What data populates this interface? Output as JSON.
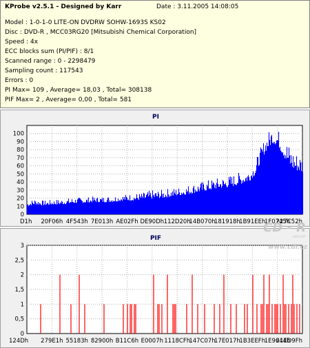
{
  "info": {
    "header": "KProbe v2.5.1 - Designed by Karr",
    "date": "Date : 3.11.2005 14:08:05",
    "lines": [
      "Model : 1-0-1-0 LITE-ON DVDRW SOHW-1693S KS02",
      "Disc : DVD-R , MCC03RG20 [Mitsubishi Chemical Corporation]",
      "Speed : 4x",
      "ECC blocks sum (PI/PIF) : 8/1",
      "Scanned range : 0 - 2298479",
      "Sampling count : 117543",
      "Errors : 0",
      "PI Max= 109 , Average= 18,03 , Total= 308138",
      "PIF Max= 2 , Average= 0,00 , Total= 581"
    ]
  },
  "watermark": {
    "brand": "CD - R",
    "sub": "server",
    "url": "www.cdr.cz"
  },
  "chart_data": [
    {
      "type": "area",
      "title": "PI",
      "color": "#0000ff",
      "ylim": [
        0,
        110
      ],
      "yticks": [
        0,
        10,
        20,
        30,
        40,
        50,
        60,
        70,
        80,
        90,
        100
      ],
      "xticks": [
        "D1h",
        "20F06h",
        "4F543h",
        "7E013h",
        "AE02Fh",
        "DE90Dh",
        "112D20h",
        "14B070h",
        "181918h",
        "1B91EEh",
        "1F0745h",
        "227C52h"
      ],
      "x_fraction": [
        0,
        0.03,
        0.06,
        0.09,
        0.12,
        0.15,
        0.18,
        0.21,
        0.24,
        0.27,
        0.3,
        0.33,
        0.36,
        0.39,
        0.42,
        0.45,
        0.48,
        0.51,
        0.54,
        0.57,
        0.6,
        0.63,
        0.66,
        0.69,
        0.72,
        0.75,
        0.78,
        0.81,
        0.83,
        0.85,
        0.87,
        0.89,
        0.91,
        0.93,
        0.95,
        0.97,
        1.0
      ],
      "base": [
        10,
        12,
        11,
        12,
        12,
        13,
        14,
        14,
        15,
        15,
        15,
        16,
        17,
        17,
        18,
        19,
        20,
        21,
        23,
        24,
        26,
        28,
        30,
        32,
        33,
        35,
        38,
        42,
        50,
        68,
        80,
        88,
        85,
        72,
        60,
        55,
        52
      ],
      "peak": [
        16,
        20,
        17,
        18,
        19,
        20,
        21,
        21,
        22,
        22,
        23,
        24,
        25,
        26,
        27,
        30,
        30,
        32,
        33,
        35,
        38,
        40,
        43,
        45,
        47,
        50,
        53,
        58,
        68,
        85,
        100,
        109,
        105,
        98,
        88,
        78,
        74
      ]
    },
    {
      "type": "bar",
      "title": "PIF",
      "color": "#ff0000",
      "ylim": [
        0,
        3
      ],
      "yticks": [
        "0",
        "0,5",
        "1",
        "1,5",
        "2",
        "2,5",
        "3"
      ],
      "ytick_values": [
        0,
        0.5,
        1,
        1.5,
        2,
        2.5,
        3
      ],
      "xticks": [
        "124Dh",
        "279E1h",
        "55183h",
        "82900h",
        "B11C6h",
        "E0007h",
        "1118CFh",
        "147C07h",
        "17E017h",
        "1B3EEFh",
        "1E9644h",
        "21ED9Fh"
      ],
      "x_fraction": [
        0.05,
        0.12,
        0.16,
        0.19,
        0.21,
        0.28,
        0.35,
        0.365,
        0.375,
        0.38,
        0.39,
        0.395,
        0.46,
        0.475,
        0.48,
        0.49,
        0.51,
        0.53,
        0.535,
        0.54,
        0.58,
        0.6,
        0.62,
        0.645,
        0.68,
        0.7,
        0.715,
        0.74,
        0.76,
        0.79,
        0.8,
        0.82,
        0.835,
        0.85,
        0.855,
        0.86,
        0.87,
        0.875,
        0.88,
        0.89,
        0.9,
        0.905,
        0.91,
        0.92,
        0.93,
        0.935,
        0.94,
        0.95,
        0.96,
        0.965,
        0.97,
        0.98,
        0.99
      ],
      "values": [
        1,
        2,
        1,
        2,
        1,
        1,
        1,
        1,
        1,
        1,
        1,
        1,
        2,
        1,
        1,
        1,
        2,
        1,
        1,
        1,
        1,
        2,
        1,
        1,
        1,
        1,
        2,
        1,
        1,
        1,
        1,
        2,
        1,
        1,
        1,
        2,
        1,
        1,
        2,
        1,
        1,
        1,
        1,
        1,
        2,
        1,
        1,
        1,
        1,
        2,
        1,
        1,
        1
      ]
    }
  ]
}
